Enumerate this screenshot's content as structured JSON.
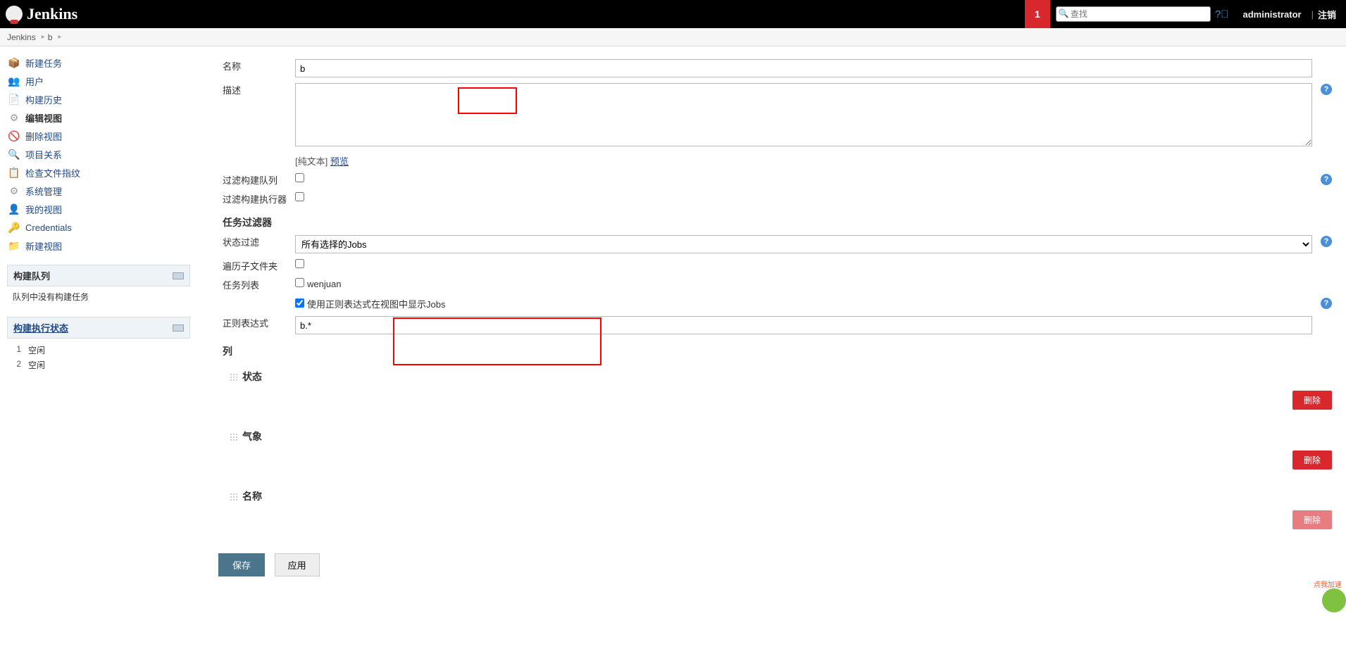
{
  "header": {
    "brand": "Jenkins",
    "notif_count": "1",
    "search_placeholder": "查找",
    "user": "administrator",
    "logout": "注销",
    "sep": "|"
  },
  "breadcrumb": {
    "root": "Jenkins",
    "current": "b"
  },
  "sidebar": {
    "items": [
      {
        "label": "新建任务"
      },
      {
        "label": "用户"
      },
      {
        "label": "构建历史"
      },
      {
        "label": "编辑视图"
      },
      {
        "label": "删除视图"
      },
      {
        "label": "项目关系"
      },
      {
        "label": "检查文件指纹"
      },
      {
        "label": "系统管理"
      },
      {
        "label": "我的视图"
      },
      {
        "label": "Credentials"
      },
      {
        "label": "新建视图"
      }
    ],
    "queue": {
      "title": "构建队列",
      "empty": "队列中没有构建任务"
    },
    "exec": {
      "title": "构建执行状态",
      "rows": [
        {
          "n": "1",
          "s": "空闲"
        },
        {
          "n": "2",
          "s": "空闲"
        }
      ]
    }
  },
  "form": {
    "name_label": "名称",
    "name_value": "b",
    "desc_label": "描述",
    "desc_plaintext": "[纯文本] ",
    "preview": "预览",
    "filter_queue_label": "过滤构建队列",
    "filter_exec_label": "过滤构建执行器",
    "jobfilter_section": "任务过滤器",
    "status_filter_label": "状态过滤",
    "status_filter_value": "所有选择的Jobs",
    "recurse_label": "遍历子文件夹",
    "jobs_label": "任务列表",
    "job_wenjuan": "wenjuan",
    "regex_cb_label": "使用正则表达式在视图中显示Jobs",
    "regex_label": "正则表达式",
    "regex_value": "b.*",
    "columns_section": "列",
    "col_status": "状态",
    "col_weather": "气象",
    "col_name": "名称",
    "delete_btn": "删除",
    "save_btn": "保存",
    "apply_btn": "应用"
  }
}
